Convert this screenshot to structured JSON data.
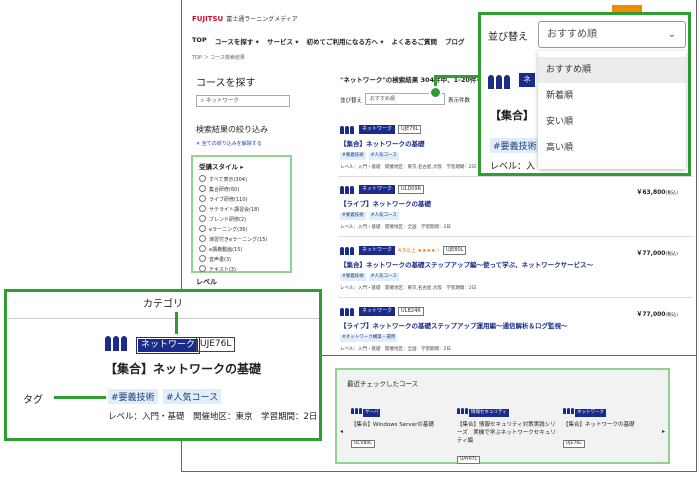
{
  "site": {
    "logo_mark": "FUJITSU",
    "logo_text": "富士通ラーニングメディア"
  },
  "nav": {
    "items": [
      "TOP",
      "コースを探す ▾",
      "サービス ▾",
      "初めてご利用になる方へ ▾",
      "よくあるご質問",
      "ブログ"
    ]
  },
  "breadcrumb": "TOP ＞ コース検索結果",
  "sidebar": {
    "title": "コースを探す",
    "search_value": "ネットワーク",
    "filter_title": "検索結果の絞り込み",
    "clear_filters": "✕ 全ての絞り込みを解除する",
    "style_heading": "受講スタイル ▸",
    "styles": [
      "すべて表示(304)",
      "集合研修(60)",
      "ライブ研修(110)",
      "サテライト講習会(18)",
      "ブレンド研修(2)",
      "eラーニング(36)",
      "演習付きeラーニング(15)",
      "e講義動画(15)",
      "音声書(3)",
      "テキスト(3)"
    ],
    "level_label": "レベル"
  },
  "results": {
    "summary": "\"ネットワーク\"の検索結果 304件中、1-20件を表示",
    "sort_label": "並び替え",
    "sort_value": "おすすめ順",
    "per_page_label": "表示件数"
  },
  "courses": [
    {
      "category": "ネットワーク",
      "code": "UJE76L",
      "rating": "",
      "title": "【集合】ネットワークの基礎",
      "tags": [
        "#要義技術",
        "#人気コース"
      ],
      "meta": "レベル：入門・基礎　開催地区：東京,名古屋,大阪　学習期間：2日",
      "price": "",
      "price_note": ""
    },
    {
      "category": "ネットワーク",
      "code": "ULD09R",
      "rating": "",
      "title": "【ライブ】ネットワークの基礎",
      "tags": [
        "#要義技術",
        "#人気コース"
      ],
      "meta": "レベル：入門・基礎　開催地区：全国　学習期間：2日",
      "price": "￥63,800",
      "price_note": "(税込)"
    },
    {
      "category": "ネットワーク",
      "code": "UJE80L",
      "rating": "4.5以上 ★★★★☆",
      "title": "【集合】ネットワークの基礎ステップアップ編～使って学ぶ、ネットワークサービス～",
      "tags": [
        "#要義技術",
        "#人気コース"
      ],
      "meta": "レベル：入門・基礎　開催地区：東京,名古屋,大阪　学習期間：2日",
      "price": "￥77,000",
      "price_note": "(税込)"
    },
    {
      "category": "ネットワーク",
      "code": "ULB24R",
      "rating": "",
      "title": "【ライブ】ネットワークの基礎ステップアップ運用編～通信解析＆ログ監視～",
      "tags": [
        "#ネットワーク構築・運用"
      ],
      "meta": "レベル：入門・基礎　開催地区：全国　学習期間：2日",
      "price": "￥77,000",
      "price_note": "(税込)"
    }
  ],
  "recent": {
    "title": "最近チェックしたコース",
    "prev": "◂",
    "next": "▸",
    "cards": [
      {
        "category": "サーバ",
        "name": "【集合】Windows Serverの基礎",
        "code": "UCV80L"
      },
      {
        "category": "情報セキュリティ",
        "name": "【集合】情報セキュリティ対策実践シリーズ　実機で学ぶネットワークセキュリティ編",
        "code": "UAY97L"
      },
      {
        "category": "ネットワーク",
        "name": "【集合】ネットワークの基礎",
        "code": "UJE76L"
      }
    ]
  },
  "sort_callout": {
    "label": "並び替え",
    "select_value": "おすすめ順",
    "chevron": "⌄",
    "options": [
      "おすすめ順",
      "新着順",
      "安い順",
      "高い順"
    ],
    "bg_category_letter": "ネ",
    "bg_title": "【集合】",
    "bg_tag": "#要義技術",
    "bg_meta": "レベル：入"
  },
  "tag_callout": {
    "category_label": "カテゴリ",
    "category": "ネットワーク",
    "code": "UJE76L",
    "title": "【集合】ネットワークの基礎",
    "tag_label": "タグ",
    "tags": [
      "#要義技術",
      "#人気コース"
    ],
    "meta": "レベル：入門・基礎　開催地区：東京　学習期間：2日"
  },
  "colors": {
    "accent_green": "#2e9e2e",
    "category_navy": "#1a2b8c",
    "tag_bg": "#e1edf8",
    "brand_orange": "#f08a00"
  }
}
